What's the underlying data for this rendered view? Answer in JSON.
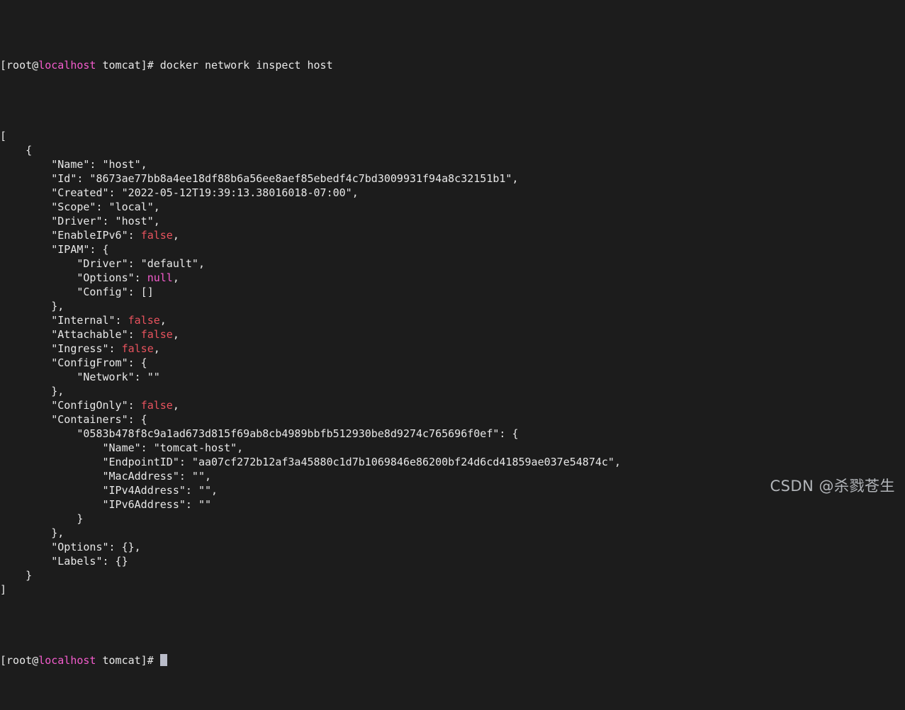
{
  "terminal": {
    "background_color": "#1c1c1c",
    "foreground_color": "#e8e8e8",
    "prompt_host_color": "#f45ccd",
    "boolean_color": "#e8535e",
    "null_color": "#f45ccd",
    "cursor_color": "#b9bcc9",
    "prompt_prefix": "[root@",
    "prompt_host": "localhost",
    "prompt_suffix": " tomcat]# ",
    "command": "docker network inspect host",
    "lines": [
      "[",
      "    {",
      "        \"Name\": \"host\",",
      "        \"Id\": \"8673ae77bb8a4ee18df88b6a56ee8aef85ebedf4c7bd3009931f94a8c32151b1\",",
      "        \"Created\": \"2022-05-12T19:39:13.38016018-07:00\",",
      "        \"Scope\": \"local\",",
      "        \"Driver\": \"host\",",
      "        \"EnableIPv6\": false,",
      "        \"IPAM\": {",
      "            \"Driver\": \"default\",",
      "            \"Options\": null,",
      "            \"Config\": []",
      "        },",
      "        \"Internal\": false,",
      "        \"Attachable\": false,",
      "        \"Ingress\": false,",
      "        \"ConfigFrom\": {",
      "            \"Network\": \"\"",
      "        },",
      "        \"ConfigOnly\": false,",
      "        \"Containers\": {",
      "            \"0583b478f8c9a1ad673d815f69ab8cb4989bbfb512930be8d9274c765696f0ef\": {",
      "                \"Name\": \"tomcat-host\",",
      "                \"EndpointID\": \"aa07cf272b12af3a45880c1d7b1069846e86200bf24d6cd41859ae037e54874c\",",
      "                \"MacAddress\": \"\",",
      "                \"IPv4Address\": \"\",",
      "                \"IPv6Address\": \"\"",
      "            }",
      "        },",
      "        \"Options\": {},",
      "        \"Labels\": {}",
      "    }",
      "]"
    ]
  },
  "inspect_result": {
    "Name": "host",
    "Id": "8673ae77bb8a4ee18df88b6a56ee8aef85ebedf4c7bd3009931f94a8c32151b1",
    "Created": "2022-05-12T19:39:13.38016018-07:00",
    "Scope": "local",
    "Driver": "host",
    "EnableIPv6": "false",
    "IPAM": {
      "Driver": "default",
      "Options": "null",
      "Config": "[]"
    },
    "Internal": "false",
    "Attachable": "false",
    "Ingress": "false",
    "ConfigFrom": {
      "Network": ""
    },
    "ConfigOnly": "false",
    "Containers": {
      "id": "0583b478f8c9a1ad673d815f69ab8cb4989bbfb512930be8d9274c765696f0ef",
      "Name": "tomcat-host",
      "EndpointID": "aa07cf272b12af3a45880c1d7b1069846e86200bf24d6cd41859ae037e54874c",
      "MacAddress": "",
      "IPv4Address": "",
      "IPv6Address": ""
    },
    "Options": "{}",
    "Labels": "{}"
  },
  "watermark": {
    "text": "CSDN @杀戮苍生"
  }
}
